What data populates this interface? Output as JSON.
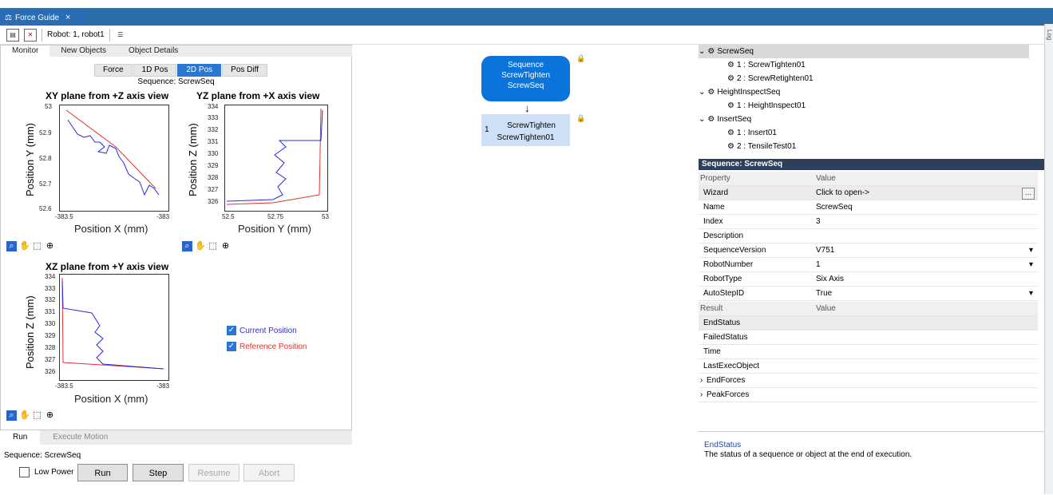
{
  "window": {
    "tab_title": "Force Guide",
    "tab_close": "×"
  },
  "toolbar": {
    "robot_label": "Robot: 1, robot1"
  },
  "side_panel": {
    "label": "Log"
  },
  "left_tabs": [
    "Monitor",
    "New Objects",
    "Object Details"
  ],
  "mode_tabs": [
    "Force",
    "1D Pos",
    "2D Pos",
    "Pos Diff"
  ],
  "mode_active": "2D Pos",
  "sequence_caption": "Sequence: ScrewSeq",
  "plots": {
    "xy": {
      "title": "XY plane from +Z axis view",
      "xlabel": "Position X (mm)",
      "ylabel": "Position Y (mm)",
      "yticks": [
        "53",
        "52.9",
        "52.8",
        "52.7",
        "52.6"
      ],
      "xticks": [
        "-383.5",
        "-383"
      ]
    },
    "yz": {
      "title": "YZ plane from +X axis view",
      "xlabel": "Position Y (mm)",
      "ylabel": "Position Z (mm)",
      "yticks": [
        "334",
        "333",
        "332",
        "331",
        "330",
        "329",
        "328",
        "327",
        "326"
      ],
      "xticks": [
        "52.5",
        "52.75",
        "53"
      ]
    },
    "xz": {
      "title": "XZ plane from +Y axis view",
      "xlabel": "Position X (mm)",
      "ylabel": "Position Z (mm)",
      "yticks": [
        "334",
        "333",
        "332",
        "331",
        "330",
        "329",
        "328",
        "327",
        "326"
      ],
      "xticks": [
        "-383.5",
        "-383"
      ]
    }
  },
  "legend": {
    "current": "Current Position",
    "reference": "Reference Position",
    "current_color": "#2b2bd9",
    "reference_color": "#e53030"
  },
  "bottom_tabs": [
    "Run",
    "Execute Motion"
  ],
  "run_panel": {
    "sequence": "Sequence: ScrewSeq",
    "low_power": "Low Power",
    "run": "Run",
    "step": "Step",
    "resume": "Resume",
    "abort": "Abort"
  },
  "flow": {
    "sequence_node": {
      "line1": "Sequence",
      "line2": "ScrewTighten",
      "line3": "ScrewSeq"
    },
    "object_node": {
      "index": "1",
      "line1": "ScrewTighten",
      "line2": "ScrewTighten01"
    }
  },
  "tree": [
    {
      "label": "ScrewSeq",
      "level": 0,
      "expanded": true,
      "selected": true
    },
    {
      "label": "1 :  ScrewTighten01",
      "level": 1
    },
    {
      "label": "2 :  ScrewRetighten01",
      "level": 1
    },
    {
      "label": "HeightInspectSeq",
      "level": 0,
      "expanded": true
    },
    {
      "label": "1 :  HeightInspect01",
      "level": 1
    },
    {
      "label": "InsertSeq",
      "level": 0,
      "expanded": true
    },
    {
      "label": "1 :  Insert01",
      "level": 1
    },
    {
      "label": "2 :  TensileTest01",
      "level": 1
    }
  ],
  "properties": {
    "header": "Sequence: ScrewSeq",
    "col_property": "Property",
    "col_value": "Value",
    "rows": [
      {
        "key": "Wizard",
        "value": "Click to open->"
      },
      {
        "key": "Name",
        "value": "ScrewSeq"
      },
      {
        "key": "Index",
        "value": "3"
      },
      {
        "key": "Description",
        "value": ""
      },
      {
        "key": "SequenceVersion",
        "value": "V751"
      },
      {
        "key": "RobotNumber",
        "value": "1"
      },
      {
        "key": "RobotType",
        "value": "Six Axis"
      },
      {
        "key": "AutoStepID",
        "value": "True"
      }
    ]
  },
  "results": {
    "col_result": "Result",
    "col_value": "Value",
    "rows": [
      "EndStatus",
      "FailedStatus",
      "Time",
      "LastExecObject",
      "EndForces",
      "PeakForces"
    ]
  },
  "help": {
    "title": "EndStatus",
    "text": "The status of a sequence or object at the end of execution."
  }
}
